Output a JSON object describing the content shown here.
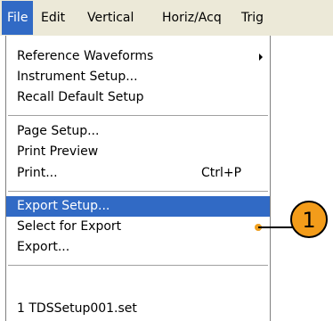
{
  "menubar": {
    "items": [
      "File",
      "Edit",
      "Vertical",
      "Horiz/Acq",
      "Trig"
    ]
  },
  "file_menu": {
    "items": [
      {
        "label": "Reference Waveforms",
        "submenu": true
      },
      {
        "label": "Instrument Setup..."
      },
      {
        "label": "Recall Default Setup"
      },
      {
        "label": "Page Setup..."
      },
      {
        "label": "Print Preview"
      },
      {
        "label": "Print...",
        "shortcut": "Ctrl+P"
      },
      {
        "label": "Export Setup...",
        "selected": true
      },
      {
        "label": "Select for Export",
        "submenu": true
      },
      {
        "label": "Export..."
      },
      {
        "label": "1 TDSSetup001.set"
      }
    ]
  },
  "callout": {
    "number": "1"
  },
  "colors": {
    "menubar_bg": "#ece9d8",
    "selection": "#316ac5",
    "callout": "#f39c1a"
  }
}
